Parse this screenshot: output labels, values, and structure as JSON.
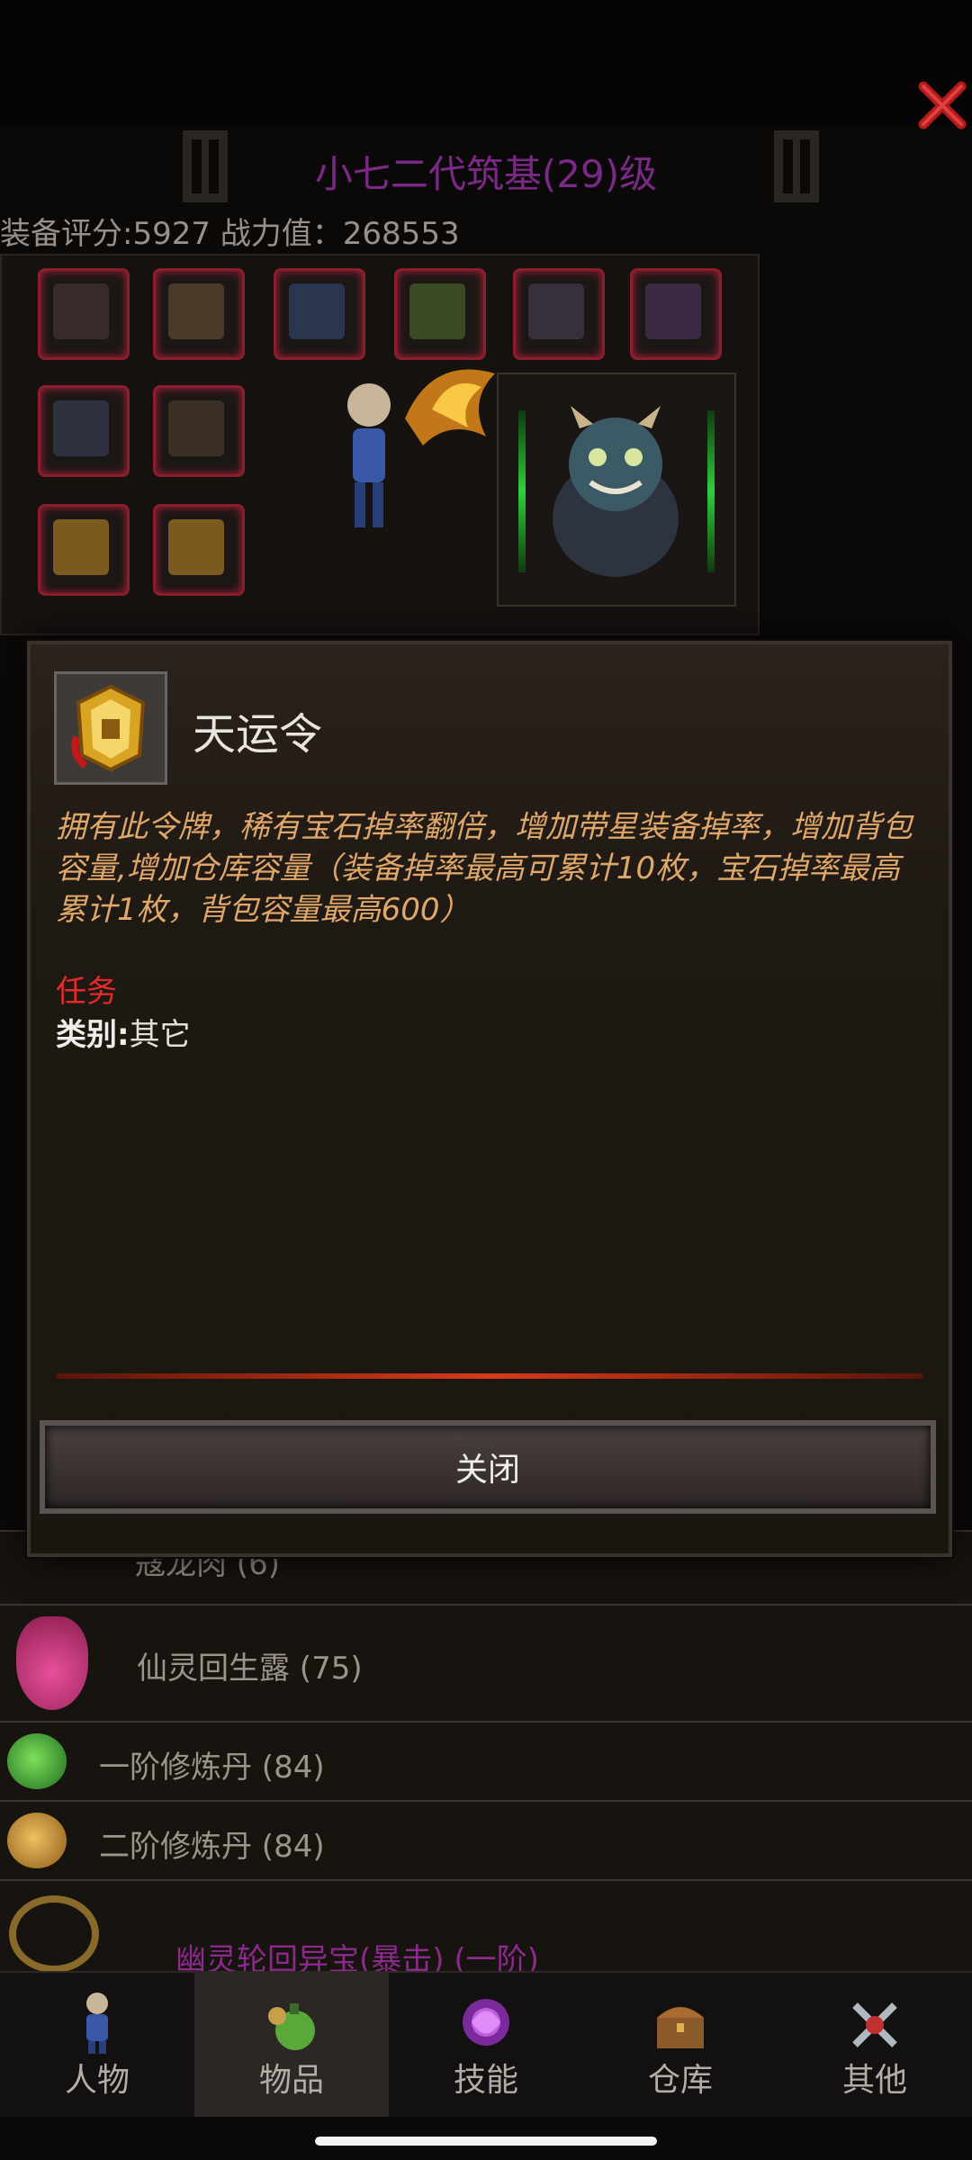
{
  "header": {
    "character_title": "小七二代筑基(29)级",
    "score_line": "装备评分:5927 战力值：268553"
  },
  "colors": {
    "accent_purple": "#7a2a86",
    "desc_orange": "#e0a76a",
    "task_red": "#e62a2a",
    "slot_red": "#8b1e2c"
  },
  "equipment": {
    "slot_icons": [
      "helmet-icon",
      "armor-icon",
      "amulet-icon",
      "shoulder-icon",
      "bracer-icon",
      "necklace-icon",
      "sword-icon",
      "blade-icon",
      "ring-icon",
      "ring-icon"
    ]
  },
  "background_list": {
    "rows": [
      {
        "label": "仙灵回生露 (75)",
        "icon": "potion-icon"
      },
      {
        "label": "一阶修炼丹 (84)",
        "icon": "green-pill-icon"
      },
      {
        "label": "二阶修炼丹 (84)",
        "icon": "gold-pill-icon"
      },
      {
        "label": "幽灵轮回异宝(暴击) (一阶)",
        "icon": "treasure-ring-icon"
      }
    ],
    "partial_row_label": "寇龙肉 (6)"
  },
  "modal": {
    "item_name": "天运令",
    "item_icon": "token-icon",
    "description": "拥有此令牌，稀有宝石掉率翻倍，增加带星装备掉率，增加背包容量,增加仓库容量（装备掉率最高可累计10枚，宝石掉率最高累计1枚，背包容量最高600）",
    "task_label": "任务",
    "category_key": "类别:",
    "category_value": "其它",
    "close_label": "关闭"
  },
  "bottom_nav": {
    "tabs": [
      {
        "label": "人物",
        "icon": "character-icon",
        "active": false
      },
      {
        "label": "物品",
        "icon": "items-bag-icon",
        "active": true
      },
      {
        "label": "技能",
        "icon": "skill-icon",
        "active": false
      },
      {
        "label": "仓库",
        "icon": "chest-icon",
        "active": false
      },
      {
        "label": "其他",
        "icon": "other-icon",
        "active": false
      }
    ]
  }
}
